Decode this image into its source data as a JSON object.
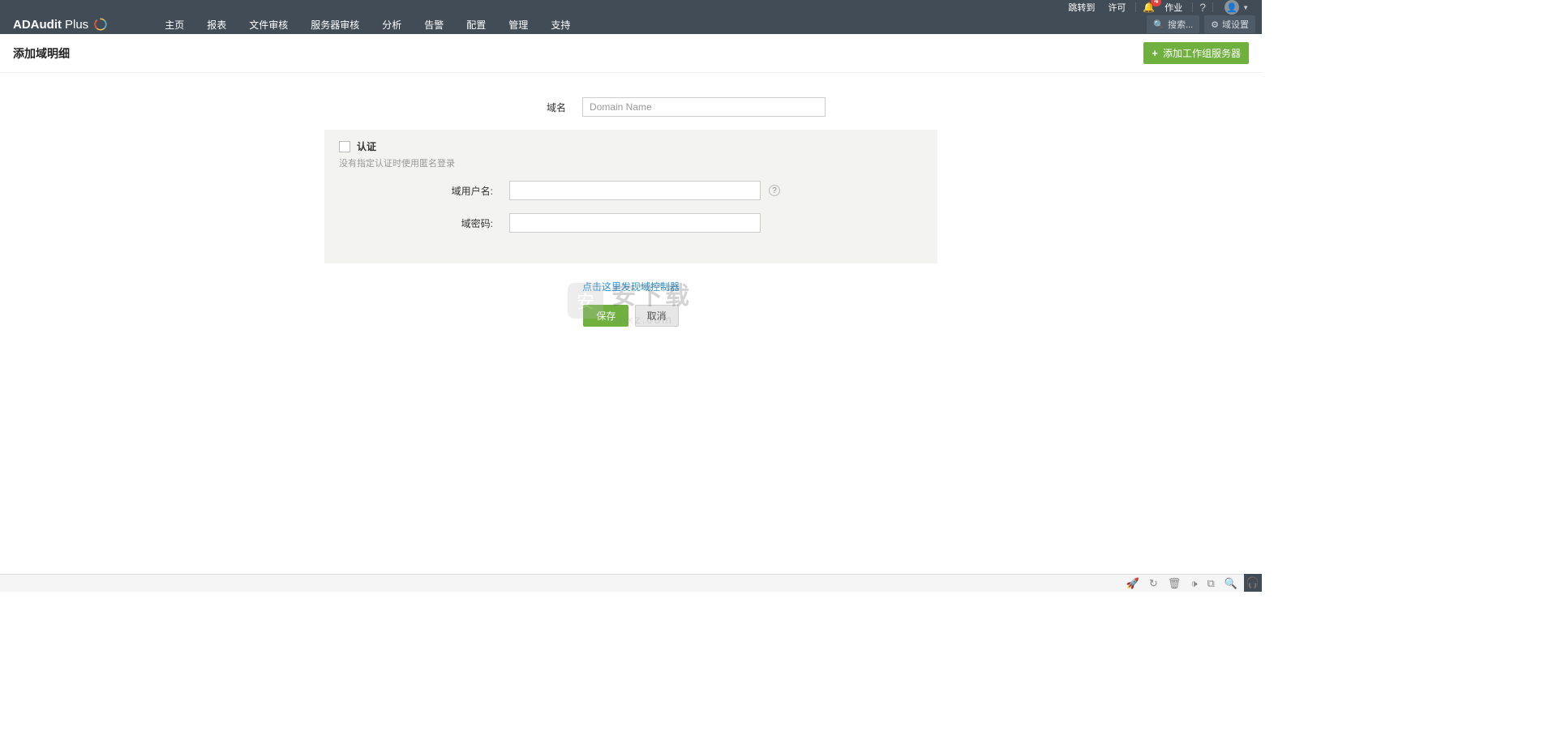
{
  "header": {
    "product_name_bold": "ADAudit",
    "product_name_thin": "Plus",
    "top_links": {
      "jump_to": "跳转到",
      "permit": "许可",
      "jobs": "作业"
    },
    "notification_count": "4",
    "nav": [
      "主页",
      "报表",
      "文件审核",
      "服务器审核",
      "分析",
      "告警",
      "配置",
      "管理",
      "支持"
    ],
    "tools": {
      "search_label": "搜索...",
      "domain_settings": "域设置"
    }
  },
  "page": {
    "title": "添加域明细",
    "add_workgroup_server": "添加工作组服务器"
  },
  "form": {
    "domain_name_label": "域名",
    "domain_name_placeholder": "Domain Name",
    "auth_label": "认证",
    "auth_hint": "没有指定认证时使用匿名登录",
    "domain_user_label": "域用户名:",
    "domain_password_label": "域密码:",
    "discover_link": "点击这里发现域控制器",
    "save": "保存",
    "cancel": "取消"
  },
  "watermark": {
    "chinese": "安下载",
    "domain": "anxz.com"
  }
}
